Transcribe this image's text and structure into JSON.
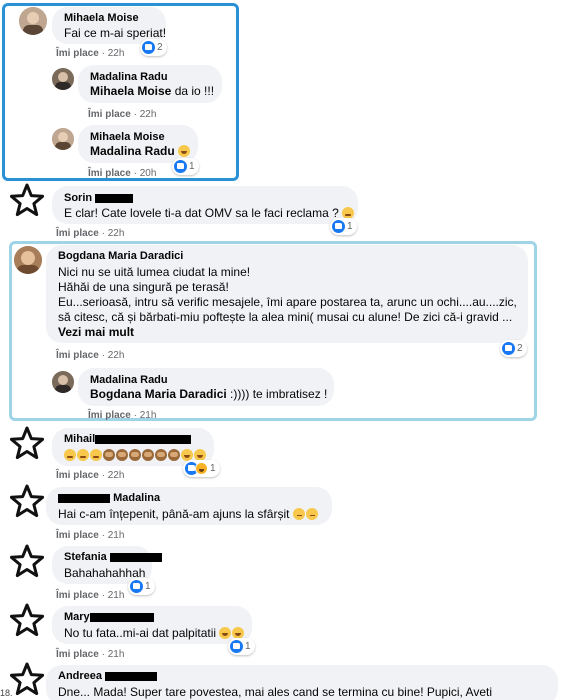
{
  "accent": "#1877f2",
  "frames": {
    "blue": "#2a91d6",
    "light": "#9fd3e6"
  },
  "like_label": "Îmi place",
  "comments": {
    "c1": {
      "author": "Mihaela Moise",
      "text": "Fai ce m-ai speriat!",
      "time": "22h",
      "count": "2"
    },
    "c1r1": {
      "author": "Madalina Radu",
      "tag": "Mihaela Moise",
      "text": " da io !!!",
      "time": "22h"
    },
    "c1r2": {
      "author": "Mihaela Moise",
      "tag": "Madalina Radu",
      "time": "20h",
      "count": "1"
    },
    "c2": {
      "author": "Sorin",
      "text": "E clar! Cate lovele ti-a dat OMV sa le faci reclama ?",
      "time": "22h",
      "count": "1"
    },
    "c3": {
      "author": "Bogdana Maria Daradici",
      "lines": [
        "Nici nu se uită lumea ciudat la mine!",
        "Hăhăi de una singură pe terasă!",
        "Eu...serioasă, intru să verific mesajele, îmi apare postarea ta, arunc un ochi....au....zic,",
        "să citesc, că și bărbati-miu poftește la alea mini( musai cu alune! De zici că-i gravid ..."
      ],
      "see_more": "Vezi mai mult",
      "time": "22h",
      "count": "2"
    },
    "c3r1": {
      "author": "Madalina Radu",
      "tag": "Bogdana Maria Daradici",
      "text": " :)))) te imbratisez !",
      "time": "21h"
    },
    "c4": {
      "author": "Mihail",
      "time": "22h",
      "count": "1"
    },
    "c5": {
      "author": "Madalina",
      "text": "Hai c-am înțepenit, până-am ajuns la sfârșit",
      "time": "21h"
    },
    "c6": {
      "author": "Stefania",
      "text": "Bahahahahhah",
      "time": "21h",
      "count": "1"
    },
    "c7": {
      "author": "Mary",
      "text": "No tu fata..mi-ai dat palpitatii",
      "time": "21h",
      "count": "1"
    },
    "c8": {
      "author": "Andreea",
      "text": "Dne... Mada! Super tare povestea, mai ales cand se termina cu bine! Pupici, Aveti"
    }
  },
  "edge_label": "18."
}
